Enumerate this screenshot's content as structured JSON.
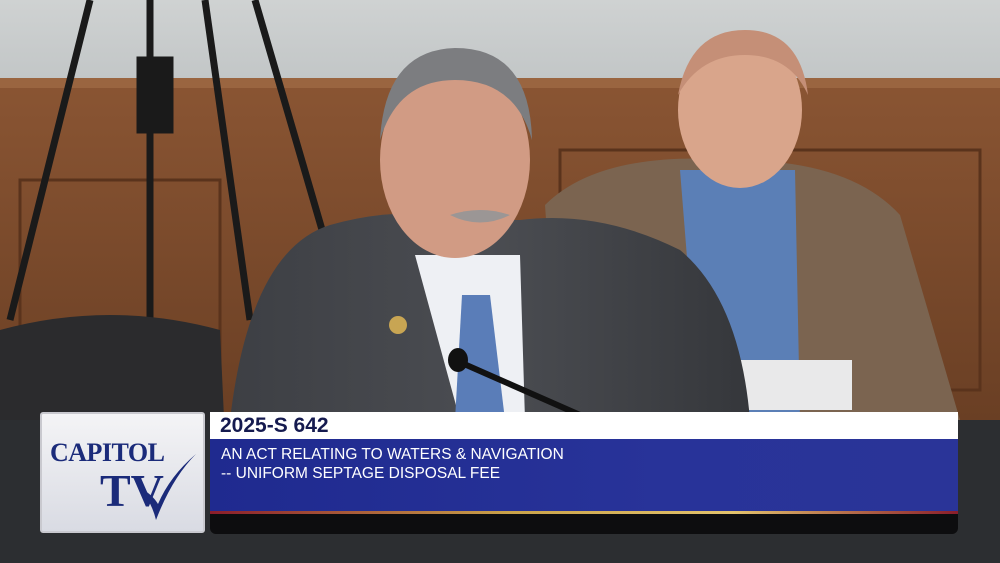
{
  "broadcast": {
    "logo_text": "CAPITOL TV",
    "bill_id": "2025-S 642",
    "bill_title_line1": "AN ACT RELATING TO WATERS & NAVIGATION",
    "bill_title_line2": "-- UNIFORM SEPTAGE DISPOSAL FEE"
  },
  "colors": {
    "banner_blue": "#283399",
    "logo_navy": "#1b2b7a",
    "gold_stripe": "#c9a24a"
  }
}
